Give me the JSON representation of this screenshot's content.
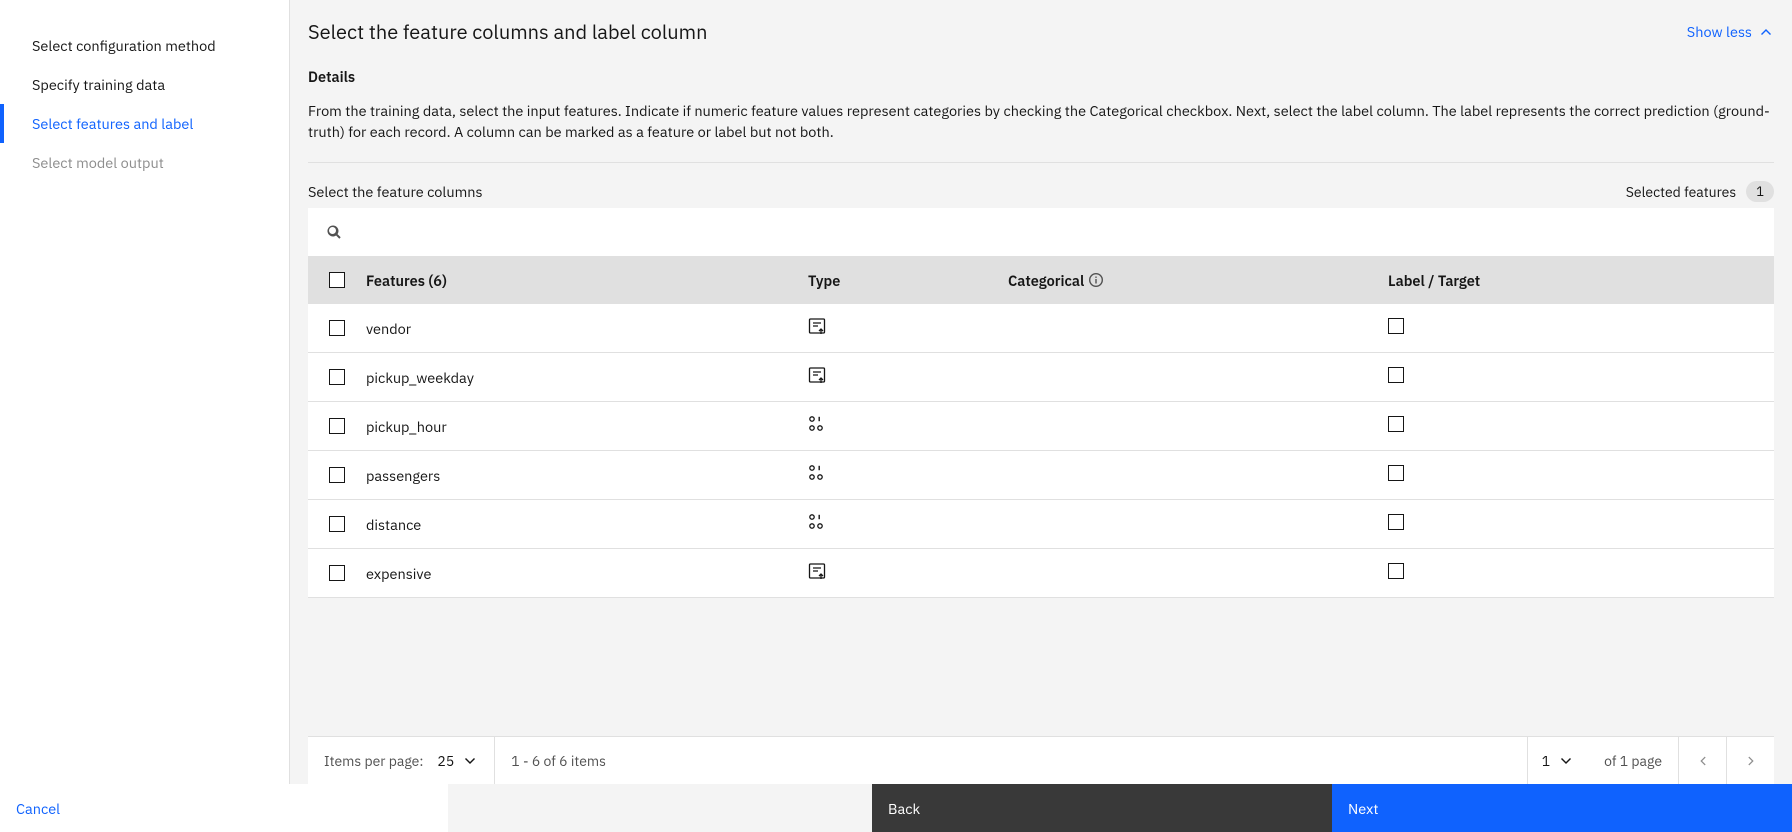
{
  "sidebar": {
    "items": [
      {
        "label": "Select configuration method",
        "state": "normal"
      },
      {
        "label": "Specify training data",
        "state": "normal"
      },
      {
        "label": "Select features and label",
        "state": "active"
      },
      {
        "label": "Select model output",
        "state": "disabled"
      }
    ]
  },
  "header": {
    "title": "Select the feature columns and label column",
    "show_less": "Show less"
  },
  "details": {
    "heading": "Details",
    "description": "From the training data, select the input features. Indicate if numeric feature values represent categories by checking the Categorical checkbox. Next, select the label column. The label represents the correct prediction (ground-truth) for each record. A column can be marked as a feature or label but not both."
  },
  "subheader": {
    "prompt": "Select the feature columns",
    "selected_label": "Selected features",
    "selected_count": "1"
  },
  "table": {
    "columns": {
      "features": "Features (6)",
      "type": "Type",
      "categorical": "Categorical",
      "label": "Label / Target"
    },
    "rows": [
      {
        "name": "vendor",
        "type": "text"
      },
      {
        "name": "pickup_weekday",
        "type": "text"
      },
      {
        "name": "pickup_hour",
        "type": "numeric"
      },
      {
        "name": "passengers",
        "type": "numeric"
      },
      {
        "name": "distance",
        "type": "numeric"
      },
      {
        "name": "expensive",
        "type": "text"
      }
    ]
  },
  "pagination": {
    "items_per_page_label": "Items per page:",
    "items_per_page_value": "25",
    "range_text": "1 - 6 of 6 items",
    "page_value": "1",
    "of_page_text": "of 1 page"
  },
  "footer": {
    "cancel": "Cancel",
    "back": "Back",
    "next": "Next"
  }
}
